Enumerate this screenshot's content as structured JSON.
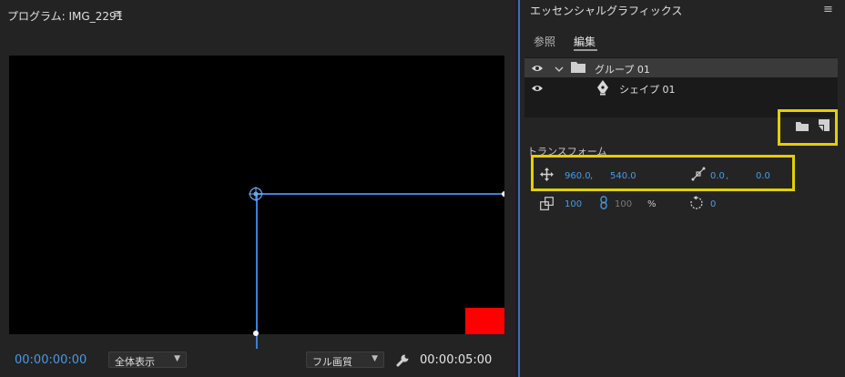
{
  "program_panel": {
    "title": "プログラム: IMG_2291",
    "menu_icon": "hamburger-menu-icon"
  },
  "viewer": {
    "object_color": "#ff0000",
    "selection_color": "#3d7fd6"
  },
  "footer": {
    "current_timecode": "00:00:00:00",
    "zoom_value": "全体表示",
    "quality_value": "フル画質",
    "settings_icon": "wrench-icon",
    "duration_timecode": "00:00:05:00"
  },
  "essential_graphics": {
    "title": "エッセンシャルグラフィックス",
    "menu_icon": "hamburger-menu-icon",
    "tabs": [
      {
        "label": "参照",
        "active": false
      },
      {
        "label": "編集",
        "active": true
      }
    ],
    "layers": [
      {
        "label": "グループ 01",
        "icon": "folder-icon",
        "visible": true,
        "expanded": true
      },
      {
        "label": "シェイプ 01",
        "icon": "pen-tool-icon",
        "visible": true
      }
    ],
    "layer_actions": [
      {
        "icon": "new-group-folder-icon"
      },
      {
        "icon": "new-layer-icon"
      }
    ],
    "transform": {
      "label": "トランスフォーム",
      "position_x": "960.0",
      "position_sep": ",",
      "position_y": "540.0",
      "anchor_x": "0.0",
      "anchor_sep": ",",
      "anchor_y": "0.0",
      "scale": "100",
      "scale_linked_value": "100",
      "scale_unit": "%",
      "rotation": "0"
    },
    "highlight_color": "#e3cf00"
  }
}
